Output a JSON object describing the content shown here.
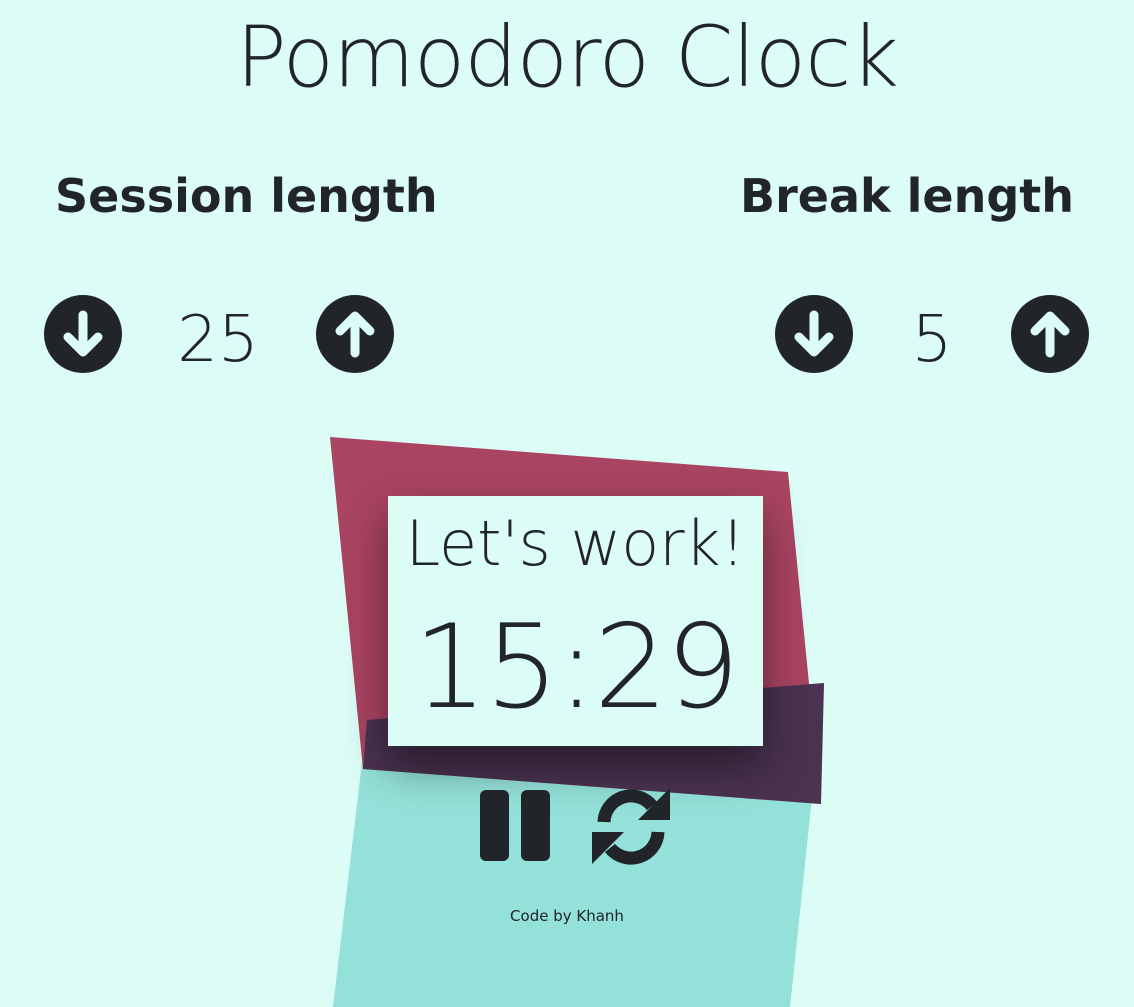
{
  "title": "Pomodoro Clock",
  "session": {
    "heading": "Session length",
    "value": "25"
  },
  "break": {
    "heading": "Break length",
    "value": "5"
  },
  "timer": {
    "label": "Let's work!",
    "time": "15:29"
  },
  "controls": {
    "decrement_icon": "arrow-circle-down-icon",
    "increment_icon": "arrow-circle-up-icon",
    "pause_icon": "pause-icon",
    "reset_icon": "sync-icon"
  },
  "credit": "Code by Khanh",
  "colors": {
    "background": "#dcfdf6",
    "text": "#212529",
    "accent_red": "#a94462",
    "accent_teal": "#93e1d8"
  }
}
